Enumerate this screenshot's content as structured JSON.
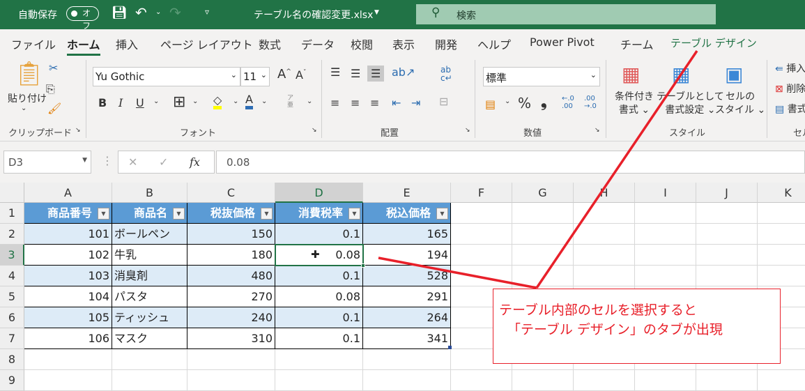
{
  "titlebar": {
    "autosave_label": "自動保存",
    "autosave_state": "オフ",
    "filename": "テーブル名の確認変更.xlsx",
    "search_placeholder": "検索"
  },
  "tabs": [
    "ファイル",
    "ホーム",
    "挿入",
    "ページ レイアウト",
    "数式",
    "データ",
    "校閲",
    "表示",
    "開発",
    "ヘルプ",
    "Power Pivot",
    "チーム",
    "テーブル デザイン"
  ],
  "active_tab": "ホーム",
  "ribbon": {
    "clipboard": {
      "paste": "貼り付け",
      "group": "クリップボード"
    },
    "font": {
      "name": "Yu Gothic",
      "size": "11",
      "bold": "B",
      "italic": "I",
      "underline": "U",
      "group": "フォント"
    },
    "alignment": {
      "group": "配置"
    },
    "number": {
      "format": "標準",
      "percent": "%",
      "comma": "❟",
      "group": "数値"
    },
    "styles": {
      "conditional": [
        "条件付き",
        "書式"
      ],
      "table_format": [
        "テーブルとして",
        "書式設定"
      ],
      "cell_styles": [
        "セルの",
        "スタイル"
      ],
      "group": "スタイル"
    },
    "cells": {
      "insert": "挿入",
      "delete": "削除",
      "format": "書式",
      "group": "セル"
    }
  },
  "formula_bar": {
    "name_box": "D3",
    "fx": "fx",
    "value": "0.08"
  },
  "columns": [
    "A",
    "B",
    "C",
    "D",
    "E",
    "F",
    "G",
    "H",
    "I",
    "J",
    "K"
  ],
  "rows": [
    "1",
    "2",
    "3",
    "4",
    "5",
    "6",
    "7",
    "8",
    "9"
  ],
  "table": {
    "headers": [
      "商品番号",
      "商品名",
      "税抜価格",
      "消費税率",
      "税込価格"
    ],
    "rows": [
      [
        "101",
        "ボールペン",
        "150",
        "0.1",
        "165"
      ],
      [
        "102",
        "牛乳",
        "180",
        "0.08",
        "194"
      ],
      [
        "103",
        "消臭剤",
        "480",
        "0.1",
        "528"
      ],
      [
        "104",
        "パスタ",
        "270",
        "0.08",
        "291"
      ],
      [
        "105",
        "ティッシュ",
        "240",
        "0.1",
        "264"
      ],
      [
        "106",
        "マスク",
        "310",
        "0.1",
        "341"
      ]
    ]
  },
  "annotation": {
    "line1": "テーブル内部のセルを選択すると",
    "line2": "「テーブル  デザイン」のタブが出現",
    "color": "#e8202a"
  },
  "colors": {
    "excel_green": "#217346",
    "table_header": "#5b9bd5",
    "table_band": "#ddebf7"
  }
}
